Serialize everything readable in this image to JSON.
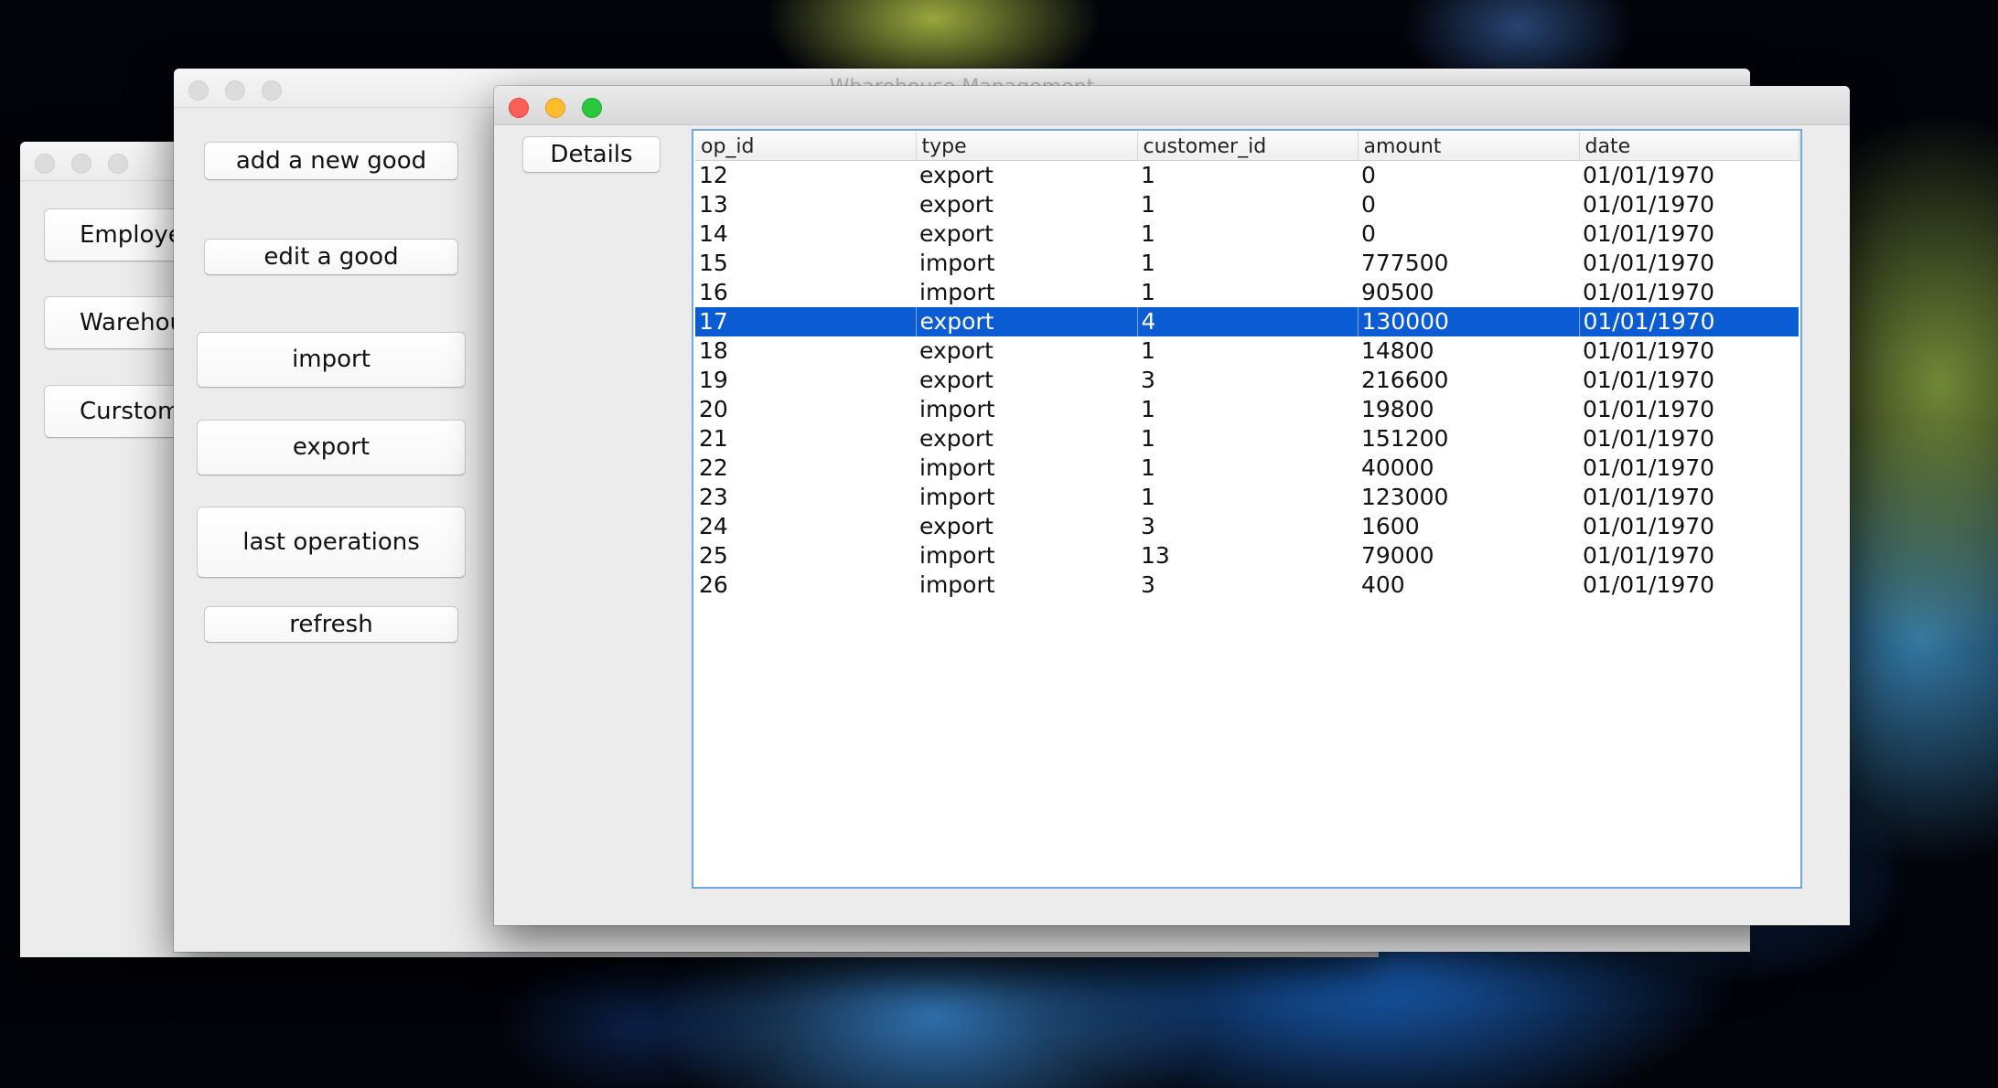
{
  "window_back": {
    "buttons": [
      "Employe",
      "Warehou",
      "Curstom"
    ]
  },
  "window_middle": {
    "title": "Wharehouse Management",
    "buttons": {
      "add_good": "add a new good",
      "edit_good": "edit a good",
      "import": "import",
      "export": "export",
      "last_operations": "last operations",
      "refresh": "refresh"
    }
  },
  "window_front": {
    "details_button": "Details",
    "table": {
      "columns": [
        "op_id",
        "type",
        "customer_id",
        "amount",
        "date"
      ],
      "rows": [
        [
          "12",
          "export",
          "1",
          "0",
          "01/01/1970"
        ],
        [
          "13",
          "export",
          "1",
          "0",
          "01/01/1970"
        ],
        [
          "14",
          "export",
          "1",
          "0",
          "01/01/1970"
        ],
        [
          "15",
          "import",
          "1",
          "777500",
          "01/01/1970"
        ],
        [
          "16",
          "import",
          "1",
          "90500",
          "01/01/1970"
        ],
        [
          "17",
          "export",
          "4",
          "130000",
          "01/01/1970"
        ],
        [
          "18",
          "export",
          "1",
          "14800",
          "01/01/1970"
        ],
        [
          "19",
          "export",
          "3",
          "216600",
          "01/01/1970"
        ],
        [
          "20",
          "import",
          "1",
          "19800",
          "01/01/1970"
        ],
        [
          "21",
          "export",
          "1",
          "151200",
          "01/01/1970"
        ],
        [
          "22",
          "import",
          "1",
          "40000",
          "01/01/1970"
        ],
        [
          "23",
          "import",
          "1",
          "123000",
          "01/01/1970"
        ],
        [
          "24",
          "export",
          "3",
          "1600",
          "01/01/1970"
        ],
        [
          "25",
          "import",
          "13",
          "79000",
          "01/01/1970"
        ],
        [
          "26",
          "import",
          "3",
          "400",
          "01/01/1970"
        ]
      ],
      "selected_row": 5
    }
  },
  "colors": {
    "selection": "#0b5bd3",
    "table_border": "#6fa8dc"
  }
}
